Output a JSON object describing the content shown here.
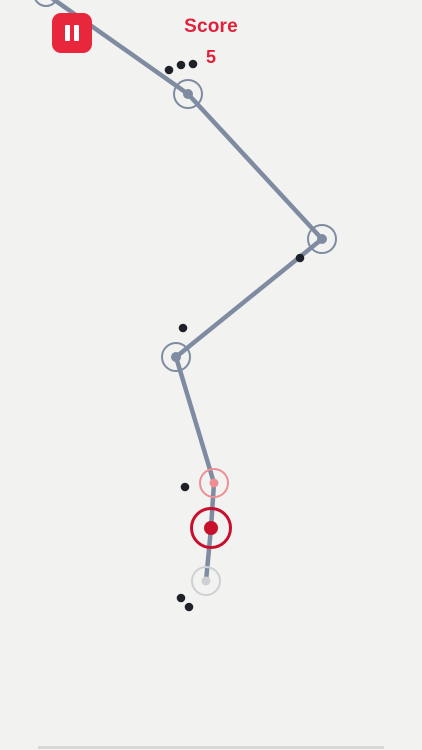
{
  "hud": {
    "score_label": "Score",
    "score_value": "5",
    "pause_icon": "pause-icon"
  },
  "colors": {
    "background": "#f2f2f1",
    "accent": "#e8273c",
    "path": "#7f8ba0",
    "node_ring": "#7f8ba0",
    "active_ring": "#c8102e",
    "next_ring": "#ee8f96",
    "previous_ring": "#cfd0d3",
    "dot": "#1e2128"
  },
  "game": {
    "path_node_count": 7,
    "obstacle_dot_count": 9,
    "active_node": "player-node",
    "upcoming_node": "target-node"
  }
}
